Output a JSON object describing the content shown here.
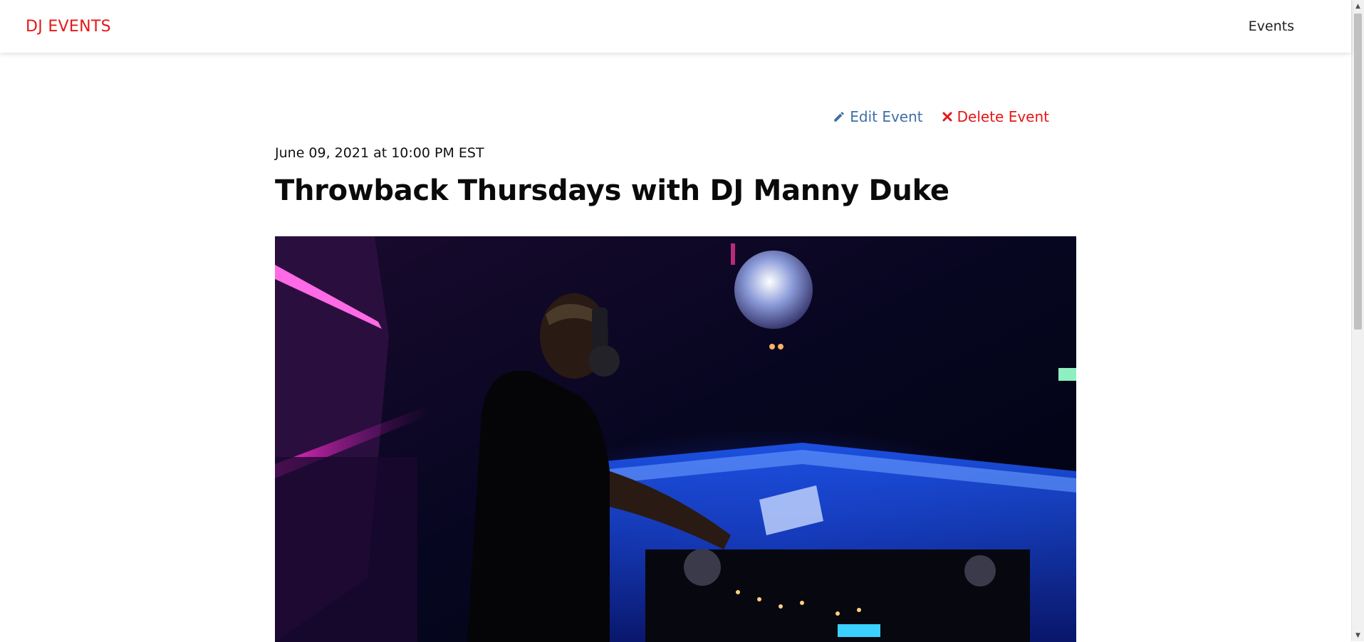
{
  "nav": {
    "brand": "DJ EVENTS",
    "links": [
      "Events"
    ]
  },
  "event": {
    "actions": {
      "edit_label": "Edit Event",
      "delete_label": "Delete Event"
    },
    "date": "June 09, 2021 at 10:00 PM EST",
    "title": "Throwback Thursdays with DJ Manny Duke"
  },
  "colors": {
    "brand": "#e51616",
    "edit": "#3e6fa8",
    "delete": "#e51616"
  },
  "icons": {
    "edit": "pencil-icon",
    "delete": "close-icon"
  }
}
